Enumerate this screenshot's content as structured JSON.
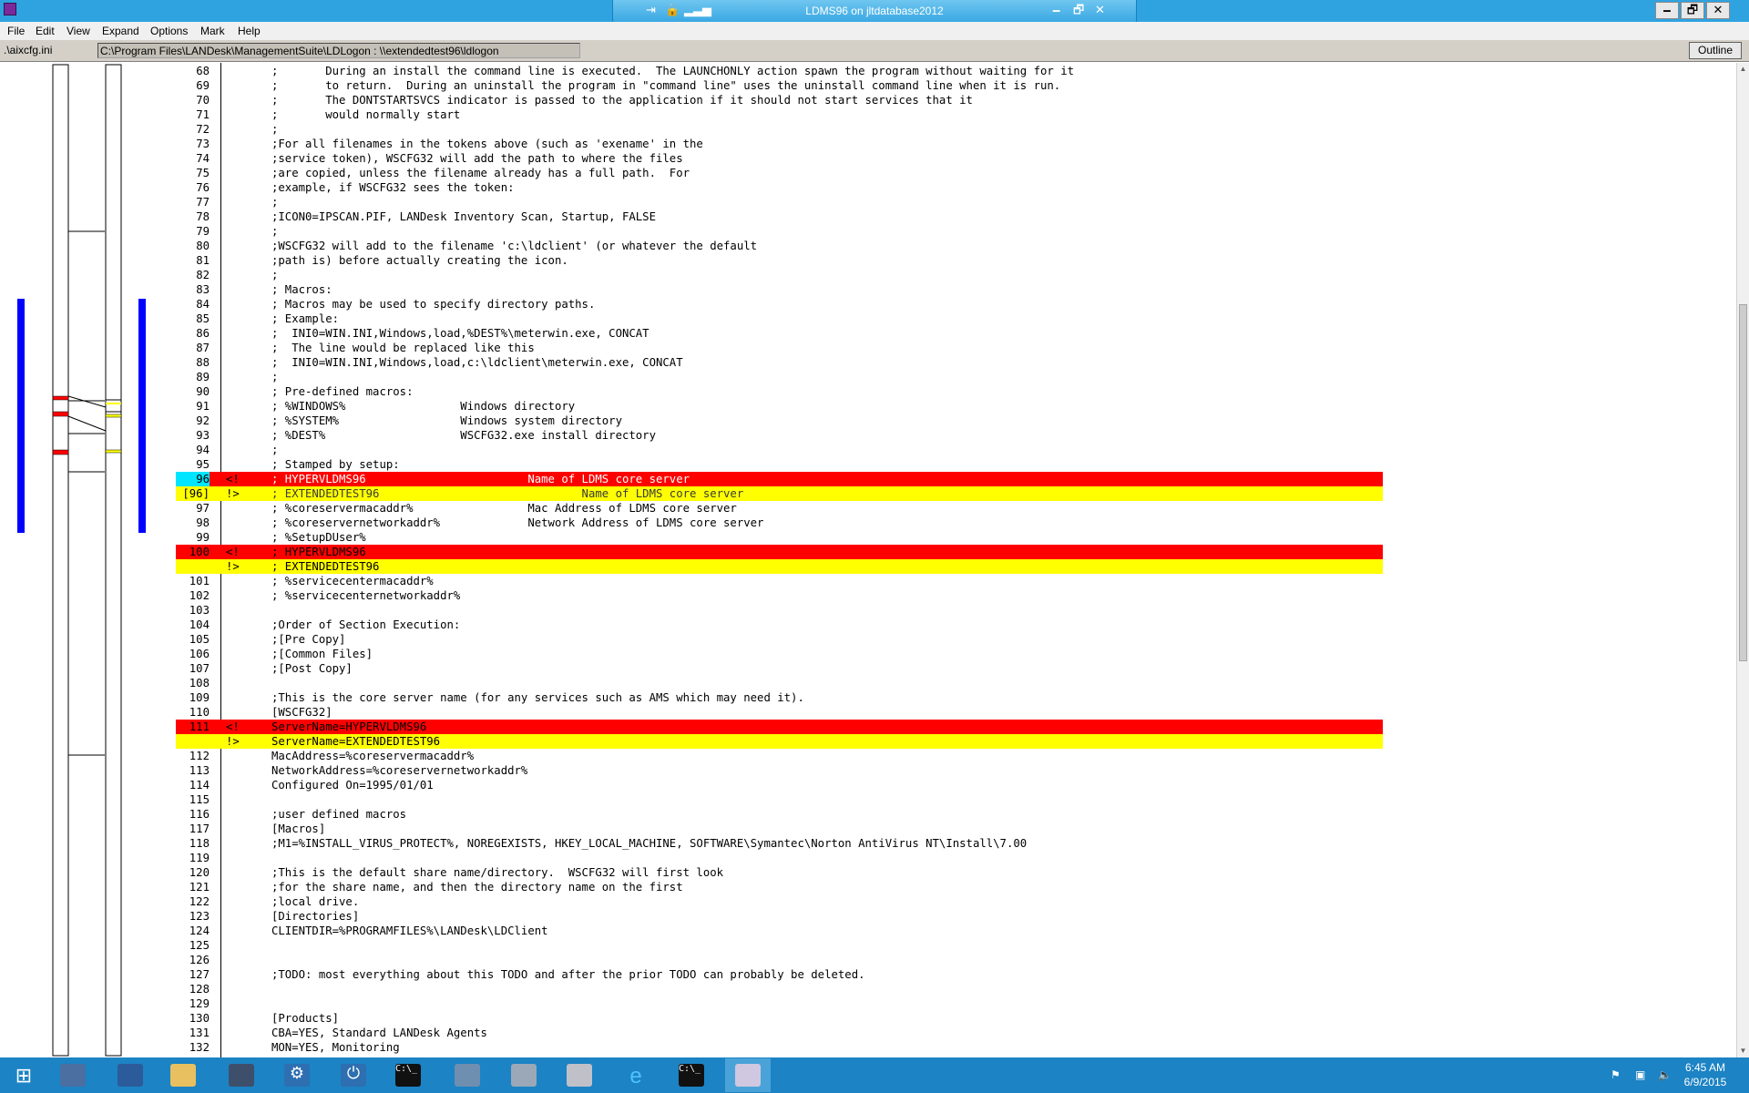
{
  "window": {
    "title": "LDMS96 on jltdatabase2012",
    "min_glyph": "🗕",
    "restore_glyph": "🗗",
    "close_glyph": "✕"
  },
  "menu": [
    "File",
    "Edit",
    "View",
    "Expand",
    "Options",
    "Mark",
    "Help"
  ],
  "paths": {
    "left": ".\\aixcfg.ini",
    "right": "C:\\Program Files\\LANDesk\\ManagementSuite\\LDLogon : \\\\extendedtest96\\ldlogon",
    "outline_button": "Outline"
  },
  "colors": {
    "deleted": "#ff0000",
    "inserted": "#ffff00",
    "changed_marker": "#0000ff",
    "taskbar": "#1c83c4"
  },
  "lines": [
    {
      "n": "68",
      "t": ";       During an install the command line is executed.  The LAUNCHONLY action spawn the program without waiting for it"
    },
    {
      "n": "69",
      "t": ";       to return.  During an uninstall the program in \"command line\" uses the uninstall command line when it is run."
    },
    {
      "n": "70",
      "t": ";       The DONTSTARTSVCS indicator is passed to the application if it should not start services that it"
    },
    {
      "n": "71",
      "t": ";       would normally start"
    },
    {
      "n": "72",
      "t": ";"
    },
    {
      "n": "73",
      "t": ";For all filenames in the tokens above (such as 'exename' in the"
    },
    {
      "n": "74",
      "t": ";service token), WSCFG32 will add the path to where the files"
    },
    {
      "n": "75",
      "t": ";are copied, unless the filename already has a full path.  For"
    },
    {
      "n": "76",
      "t": ";example, if WSCFG32 sees the token:"
    },
    {
      "n": "77",
      "t": ";"
    },
    {
      "n": "78",
      "t": ";ICON0=IPSCAN.PIF, LANDesk Inventory Scan, Startup, FALSE"
    },
    {
      "n": "79",
      "t": ";"
    },
    {
      "n": "80",
      "t": ";WSCFG32 will add to the filename 'c:\\ldclient' (or whatever the default"
    },
    {
      "n": "81",
      "t": ";path is) before actually creating the icon."
    },
    {
      "n": "82",
      "t": ";"
    },
    {
      "n": "83",
      "t": "; Macros:"
    },
    {
      "n": "84",
      "t": "; Macros may be used to specify directory paths."
    },
    {
      "n": "85",
      "t": "; Example:"
    },
    {
      "n": "86",
      "t": ";  INI0=WIN.INI,Windows,load,%DEST%\\meterwin.exe, CONCAT"
    },
    {
      "n": "87",
      "t": ";  The line would be replaced like this"
    },
    {
      "n": "88",
      "t": ";  INI0=WIN.INI,Windows,load,c:\\ldclient\\meterwin.exe, CONCAT"
    },
    {
      "n": "89",
      "t": ";"
    },
    {
      "n": "90",
      "t": "; Pre-defined macros:"
    },
    {
      "n": "91",
      "t": "; %WINDOWS%                 Windows directory"
    },
    {
      "n": "92",
      "t": "; %SYSTEM%                  Windows system directory"
    },
    {
      "n": "93",
      "t": "; %DEST%                    WSCFG32.exe install directory"
    },
    {
      "n": "94",
      "t": ";"
    },
    {
      "n": "95",
      "t": "; Stamped by setup:"
    },
    {
      "n": "96",
      "m": "<!",
      "k": "del",
      "t": "; HYPERVLDMS96                        Name of LDMS core server"
    },
    {
      "n": "[96]",
      "m": "!>",
      "k": "ins",
      "t": "; EXTENDEDTEST96                              Name of LDMS core server"
    },
    {
      "n": "97",
      "t": "; %coreservermacaddr%                 Mac Address of LDMS core server"
    },
    {
      "n": "98",
      "t": "; %coreservernetworkaddr%             Network Address of LDMS core server"
    },
    {
      "n": "99",
      "t": "; %SetupDUser%"
    },
    {
      "n": "100",
      "m": "<!",
      "k": "del",
      "t": "; HYPERVLDMS96"
    },
    {
      "n": "",
      "m": "!>",
      "k": "ins",
      "t": "; EXTENDEDTEST96"
    },
    {
      "n": "101",
      "t": "; %servicecentermacaddr%"
    },
    {
      "n": "102",
      "t": "; %servicecenternetworkaddr%"
    },
    {
      "n": "103",
      "t": ""
    },
    {
      "n": "104",
      "t": ";Order of Section Execution:"
    },
    {
      "n": "105",
      "t": ";[Pre Copy]"
    },
    {
      "n": "106",
      "t": ";[Common Files]"
    },
    {
      "n": "107",
      "t": ";[Post Copy]"
    },
    {
      "n": "108",
      "t": ""
    },
    {
      "n": "109",
      "t": ";This is the core server name (for any services such as AMS which may need it)."
    },
    {
      "n": "110",
      "t": "[WSCFG32]"
    },
    {
      "n": "111",
      "m": "<!",
      "k": "del",
      "t": "ServerName=HYPERVLDMS96"
    },
    {
      "n": "",
      "m": "!>",
      "k": "ins",
      "t": "ServerName=EXTENDEDTEST96"
    },
    {
      "n": "112",
      "t": "MacAddress=%coreservermacaddr%"
    },
    {
      "n": "113",
      "t": "NetworkAddress=%coreservernetworkaddr%"
    },
    {
      "n": "114",
      "t": "Configured On=1995/01/01"
    },
    {
      "n": "115",
      "t": ""
    },
    {
      "n": "116",
      "t": ";user defined macros"
    },
    {
      "n": "117",
      "t": "[Macros]"
    },
    {
      "n": "118",
      "t": ";M1=%INSTALL_VIRUS_PROTECT%, NOREGEXISTS, HKEY_LOCAL_MACHINE, SOFTWARE\\Symantec\\Norton AntiVirus NT\\Install\\7.00"
    },
    {
      "n": "119",
      "t": ""
    },
    {
      "n": "120",
      "t": ";This is the default share name/directory.  WSCFG32 will first look"
    },
    {
      "n": "121",
      "t": ";for the share name, and then the directory name on the first"
    },
    {
      "n": "122",
      "t": ";local drive."
    },
    {
      "n": "123",
      "t": "[Directories]"
    },
    {
      "n": "124",
      "t": "CLIENTDIR=%PROGRAMFILES%\\LANDesk\\LDClient"
    },
    {
      "n": "125",
      "t": ""
    },
    {
      "n": "126",
      "t": ""
    },
    {
      "n": "127",
      "t": ";TODO: most everything about this TODO and after the prior TODO can probably be deleted."
    },
    {
      "n": "128",
      "t": ""
    },
    {
      "n": "129",
      "t": ""
    },
    {
      "n": "130",
      "t": "[Products]"
    },
    {
      "n": "131",
      "t": "CBA=YES, Standard LANDesk Agents"
    },
    {
      "n": "132",
      "t": "MON=YES, Monitoring"
    }
  ],
  "taskbar": {
    "apps": [
      {
        "name": "start-button",
        "icon": "windows-logo-icon"
      },
      {
        "name": "taskbar-server-manager",
        "icon": "server-manager-icon"
      },
      {
        "name": "taskbar-powershell",
        "icon": "powershell-icon"
      },
      {
        "name": "taskbar-file-explorer",
        "icon": "folder-icon"
      },
      {
        "name": "taskbar-remote-control",
        "icon": "remote-control-icon"
      },
      {
        "name": "taskbar-settings",
        "icon": "gear-icon"
      },
      {
        "name": "taskbar-shutdown",
        "icon": "power-icon"
      },
      {
        "name": "taskbar-command-prompt",
        "icon": "command-prompt-icon"
      },
      {
        "name": "taskbar-control-panel",
        "icon": "control-panel-icon"
      },
      {
        "name": "taskbar-installer",
        "icon": "installer-icon"
      },
      {
        "name": "taskbar-services",
        "icon": "services-icon"
      },
      {
        "name": "taskbar-internet-explorer",
        "icon": "internet-explorer-icon"
      },
      {
        "name": "taskbar-command-prompt-2",
        "icon": "command-prompt-icon"
      },
      {
        "name": "taskbar-windiff",
        "icon": "windiff-icon"
      }
    ],
    "time": "6:45 AM",
    "date": "6/9/2015"
  }
}
